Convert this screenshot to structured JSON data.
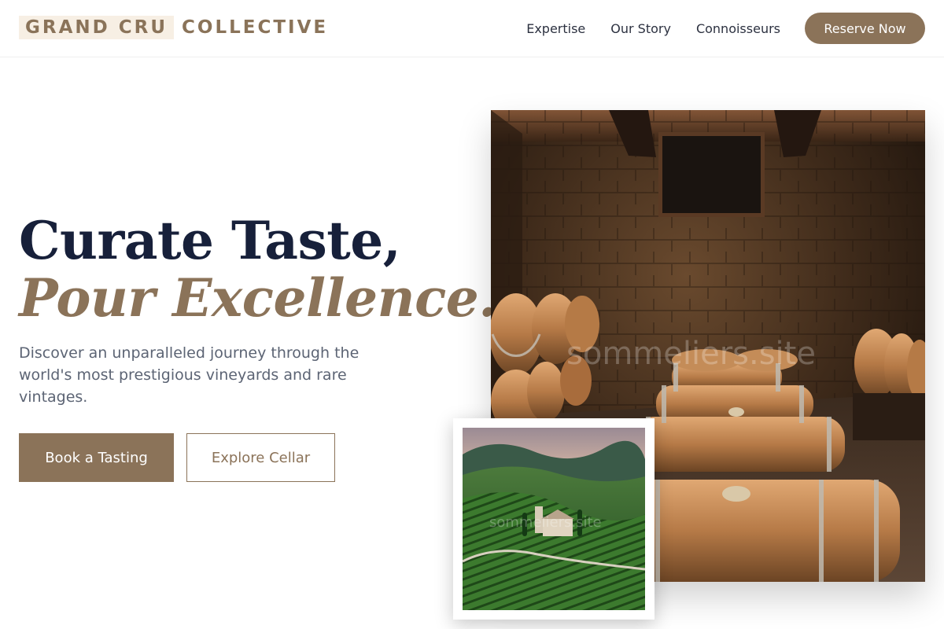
{
  "brand": {
    "highlight": "GRAND CRU",
    "rest": "COLLECTIVE"
  },
  "nav": {
    "links": [
      "Expertise",
      "Our Story",
      "Connoisseurs"
    ],
    "cta": "Reserve Now"
  },
  "hero": {
    "title_line1": "Curate Taste,",
    "title_line2": "Pour Excellence.",
    "description": "Discover an unparalleled journey through the world's most prestigious vineyards and rare vintages.",
    "primary_button": "Book a Tasting",
    "secondary_button": "Explore Cellar"
  },
  "images": {
    "watermark": "sommeliers.site"
  },
  "colors": {
    "accent": "#8b7359",
    "heading": "#17203a",
    "body_text": "#5c6474",
    "brand_highlight_bg": "#f7efe4"
  }
}
